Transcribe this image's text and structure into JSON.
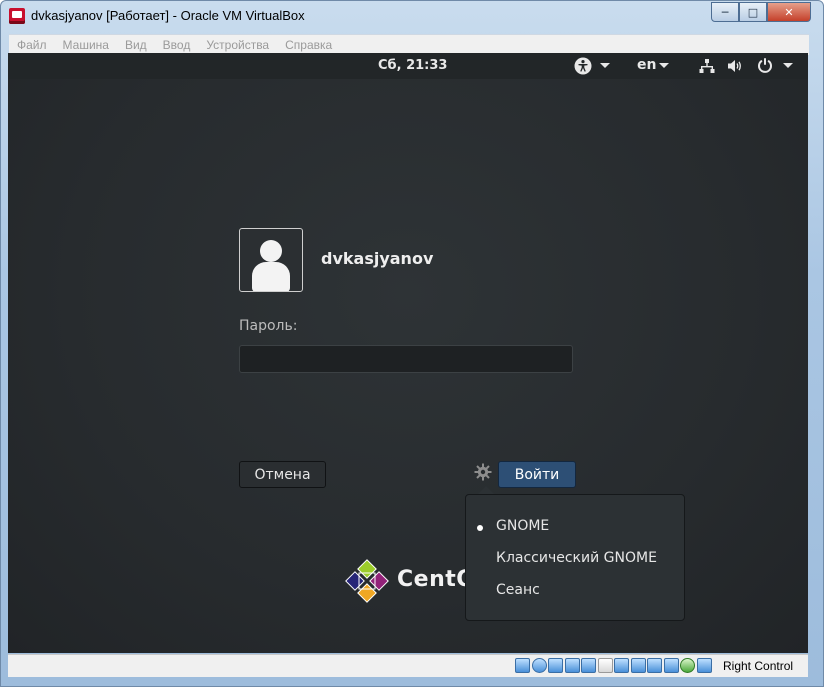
{
  "window": {
    "title": "dvkasjyanov [Работает] - Oracle VM VirtualBox",
    "minimize_glyph": "─",
    "maximize_glyph": "□",
    "close_glyph": "✕"
  },
  "menubar": {
    "items": [
      "Файл",
      "Машина",
      "Вид",
      "Ввод",
      "Устройства",
      "Справка"
    ]
  },
  "topbar": {
    "clock": "Сб, 21:33",
    "language": "en",
    "icons": [
      "accessibility-icon",
      "network-icon",
      "volume-icon",
      "power-icon"
    ]
  },
  "login": {
    "username": "dvkasjyanov",
    "password_label": "Пароль:",
    "password_value": "",
    "cancel_label": "Отмена",
    "login_label": "Войти"
  },
  "session_menu": {
    "items": [
      "GNOME",
      "Классический GNOME",
      "Сеанс"
    ],
    "selected": "GNOME"
  },
  "logo": {
    "text": "CentOS"
  },
  "statusbar": {
    "host_key": "Right Control"
  },
  "colors": {
    "login_button": "#2d4f75",
    "desktop_bg": "#272b2e",
    "topbar_bg": "#222628"
  }
}
